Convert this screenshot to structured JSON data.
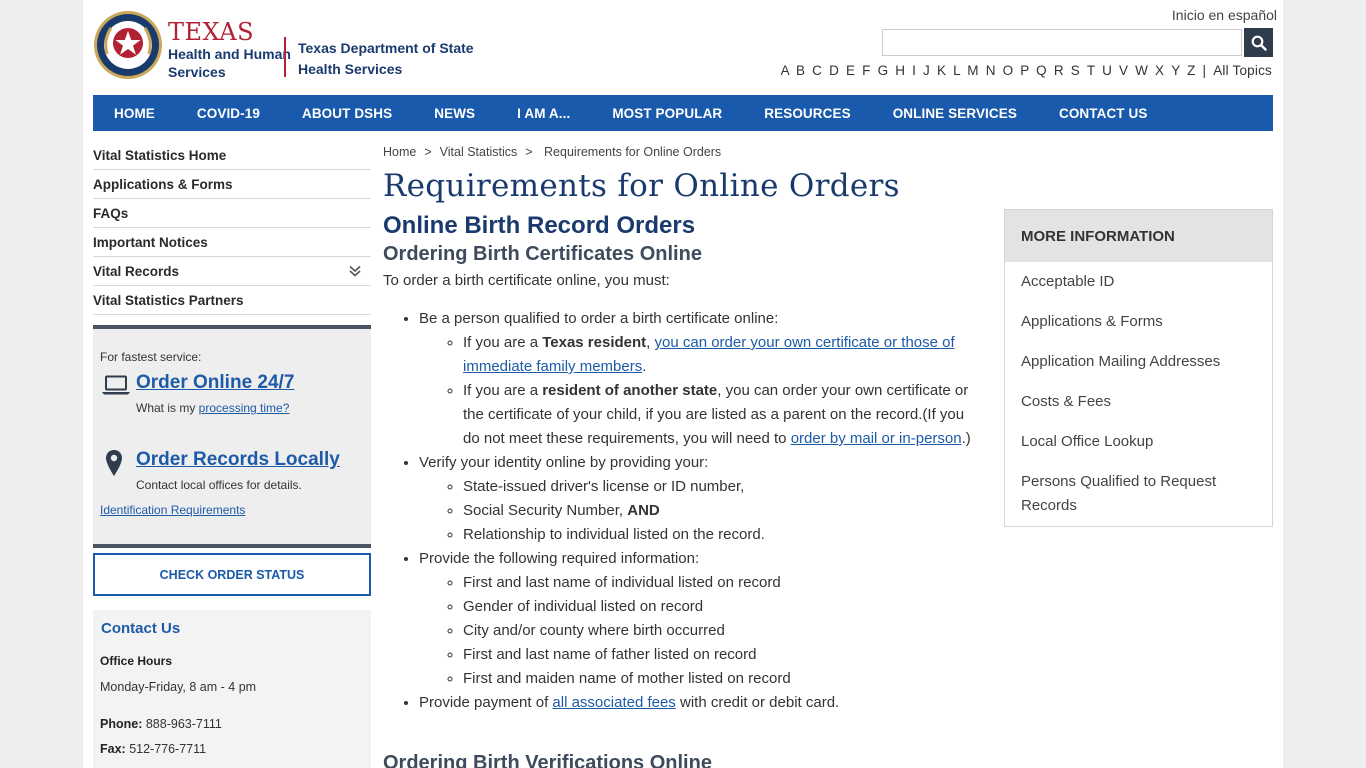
{
  "header": {
    "hhs_title": "TEXAS",
    "hhs_subtitle_1": "Health and Human",
    "hhs_subtitle_2": "Services",
    "dshs_line_1": "Texas Department of State",
    "dshs_line_2": "Health Services",
    "espanol_link": "Inicio en español",
    "search_placeholder": "",
    "az_letters": [
      "A",
      "B",
      "C",
      "D",
      "E",
      "F",
      "G",
      "H",
      "I",
      "J",
      "K",
      "L",
      "M",
      "N",
      "O",
      "P",
      "Q",
      "R",
      "S",
      "T",
      "U",
      "V",
      "W",
      "X",
      "Y",
      "Z"
    ],
    "az_sep": "|",
    "all_topics": "All Topics"
  },
  "nav": {
    "items": [
      "HOME",
      "COVID-19",
      "ABOUT DSHS",
      "NEWS",
      "I AM A...",
      "MOST POPULAR",
      "RESOURCES",
      "ONLINE SERVICES",
      "CONTACT US"
    ]
  },
  "sidebar": {
    "items": [
      "Vital Statistics Home",
      "Applications & Forms",
      "FAQs",
      "Important Notices",
      "Vital Records",
      "Vital Statistics Partners"
    ],
    "order_box": {
      "fastest": "For fastest service:",
      "online": "Order Online 24/7",
      "processing_prefix": "What is my ",
      "processing_link": "processing time?",
      "local": "Order Records Locally",
      "local_sub": "Contact local offices for details.",
      "id_link": "Identification Requirements"
    },
    "check_status": "CHECK ORDER STATUS",
    "contact": {
      "title": "Contact Us",
      "hours_label": "Office Hours",
      "hours": "Monday-Friday, 8 am - 4 pm",
      "phone_label": "Phone:",
      "phone": "888-963-7111",
      "fax_label": "Fax:",
      "fax": "512-776-7711"
    }
  },
  "breadcrumb": {
    "home": "Home",
    "vital": "Vital Statistics",
    "sep": ">",
    "current": "Requirements for Online Orders"
  },
  "main": {
    "title": "Requirements for Online Orders",
    "h2": "Online Birth Record Orders",
    "h3": "Ordering Birth Certificates Online",
    "intro": "To order a birth certificate online, you must:",
    "b1": "Be a person qualified to order a birth certificate online:",
    "b1s1_pre": "If you are a ",
    "b1s1_bold": "Texas resident",
    "b1s1_comma": ", ",
    "b1s1_link": "you can order your own certificate or those of immediate family members",
    "b1s1_end": ".",
    "b1s2_pre": "If you are a ",
    "b1s2_bold": "resident of another state",
    "b1s2_mid": ", you can order your own certificate or the certificate of your child, if you are listed as a parent on the record.(If you do not meet these requirements, you will need to ",
    "b1s2_link": "order by mail or in-person",
    "b1s2_end": ".)",
    "b2": "Verify your identity online by providing your:",
    "b2s1": "State-issued driver's license or ID number,",
    "b2s2_pre": "Social Security Number, ",
    "b2s2_bold": "AND",
    "b2s3": "Relationship to individual listed on the record.",
    "b3": "Provide the following required information:",
    "b3_items": [
      "First and last name of individual listed on record",
      "Gender of individual listed on record",
      "City and/or county where birth occurred",
      "First and last name of father listed on record",
      "First and maiden name of mother listed on record"
    ],
    "b4_pre": "Provide payment of ",
    "b4_link": "all associated fees",
    "b4_end": " with credit or debit card.",
    "h3b": "Ordering Birth Verifications Online"
  },
  "more_info": {
    "title": "MORE INFORMATION",
    "items": [
      "Acceptable ID",
      "Applications & Forms",
      "Application Mailing Addresses",
      "Costs & Fees",
      "Local Office Lookup",
      "Persons Qualified to Request Records"
    ]
  },
  "colors": {
    "nav_blue": "#1a5aac",
    "title_navy": "#1a3a6e",
    "link_blue": "#1d5aa8",
    "texas_red": "#b22234"
  }
}
